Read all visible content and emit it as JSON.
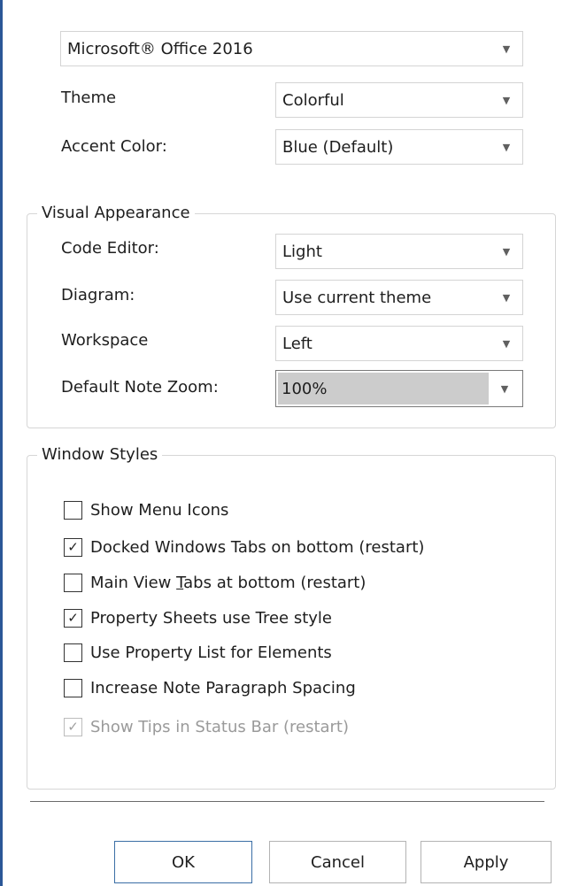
{
  "style_combo": {
    "value": "Microsoft® Office 2016"
  },
  "theme": {
    "label": "Theme",
    "value": "Colorful"
  },
  "accent": {
    "label": "Accent Color:",
    "value": "Blue (Default)"
  },
  "visual": {
    "title": "Visual Appearance",
    "code_editor": {
      "label": "Code Editor:",
      "value": "Light"
    },
    "diagram": {
      "label": "Diagram:",
      "value": "Use current theme"
    },
    "workspace": {
      "label": "Workspace",
      "value": "Left"
    },
    "note_zoom": {
      "label": "Default Note Zoom:",
      "value": "100%"
    }
  },
  "window_styles": {
    "title": "Window Styles",
    "items": [
      {
        "pre": "Show Menu Icons",
        "ul": "",
        "post": "",
        "checked": false,
        "enabled": true
      },
      {
        "pre": "Docked Windows Tabs on bottom (restart)",
        "ul": "",
        "post": "",
        "checked": true,
        "enabled": true
      },
      {
        "pre": "Main View ",
        "ul": "T",
        "post": "abs at bottom (restart)",
        "checked": false,
        "enabled": true
      },
      {
        "pre": "Property Sheets use Tree style",
        "ul": "",
        "post": "",
        "checked": true,
        "enabled": true
      },
      {
        "pre": "Use Property List for Elements",
        "ul": "",
        "post": "",
        "checked": false,
        "enabled": true
      },
      {
        "pre": "Increase Note Paragraph Spacing",
        "ul": "",
        "post": "",
        "checked": false,
        "enabled": true
      },
      {
        "pre": "Show Tips in Status Bar (restart)",
        "ul": "",
        "post": "",
        "checked": true,
        "enabled": false
      }
    ]
  },
  "buttons": {
    "ok": "OK",
    "cancel": "Cancel",
    "apply": "Apply"
  },
  "glyphs": {
    "dropdown": "▼",
    "check": "✓"
  },
  "colors": {
    "frame": "#2b5797",
    "selection": "#cccccc",
    "default_button_border": "#3a6ea5"
  }
}
